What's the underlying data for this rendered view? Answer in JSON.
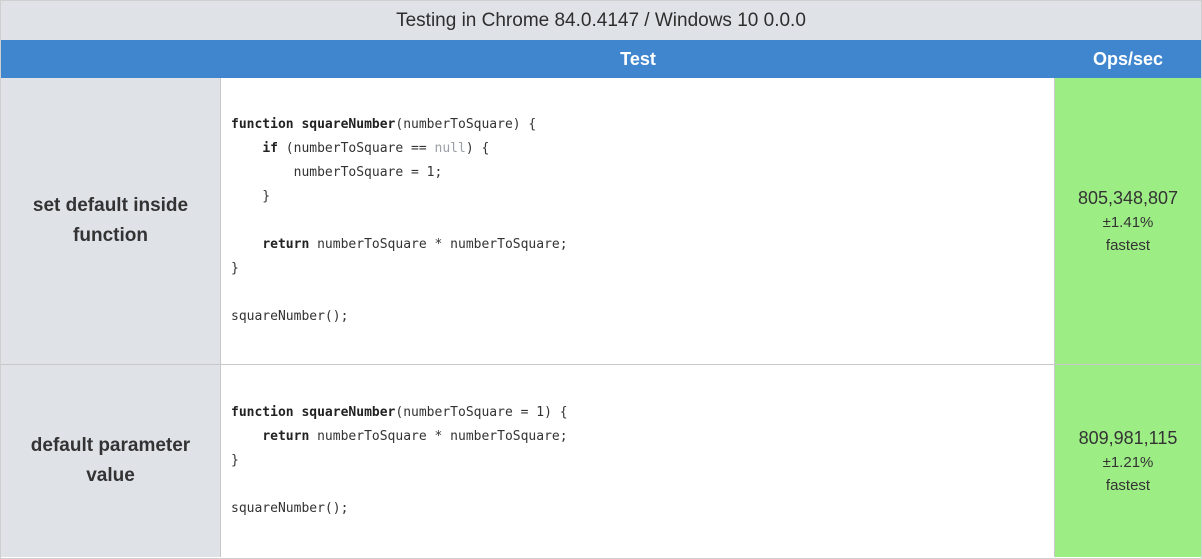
{
  "caption": "Testing in Chrome 84.0.4147 / Windows 10 0.0.0",
  "header": {
    "name": "",
    "test": "Test",
    "ops": "Ops/sec"
  },
  "colors": {
    "header_blue": "#3f86cf",
    "name_gray": "#dfe3e8",
    "fastest_green": "#9ded85"
  },
  "tests": [
    {
      "name": "set default inside function",
      "code": {
        "l1_kw": "function",
        "l1_fn": "squareNumber",
        "l1_rest": "(numberToSquare) {",
        "l2_ind": "    ",
        "l2_kw": "if",
        "l2_a": " (numberToSquare == ",
        "l2_lit": "null",
        "l2_b": ") {",
        "l3": "        numberToSquare = 1;",
        "l4": "    }",
        "l6_ind": "    ",
        "l6_kw": "return",
        "l6_rest": " numberToSquare * numberToSquare;",
        "l7": "}",
        "l9": "squareNumber();"
      },
      "ops": "805,348,807",
      "error": "±1.41%",
      "rank": "fastest"
    },
    {
      "name": "default parameter value",
      "code": {
        "l1_kw": "function",
        "l1_fn": "squareNumber",
        "l1_rest": "(numberToSquare = 1) {",
        "l2_ind": "    ",
        "l2_kw": "return",
        "l2_rest": " numberToSquare * numberToSquare;",
        "l3": "}",
        "l5": "squareNumber();"
      },
      "ops": "809,981,115",
      "error": "±1.21%",
      "rank": "fastest"
    }
  ]
}
